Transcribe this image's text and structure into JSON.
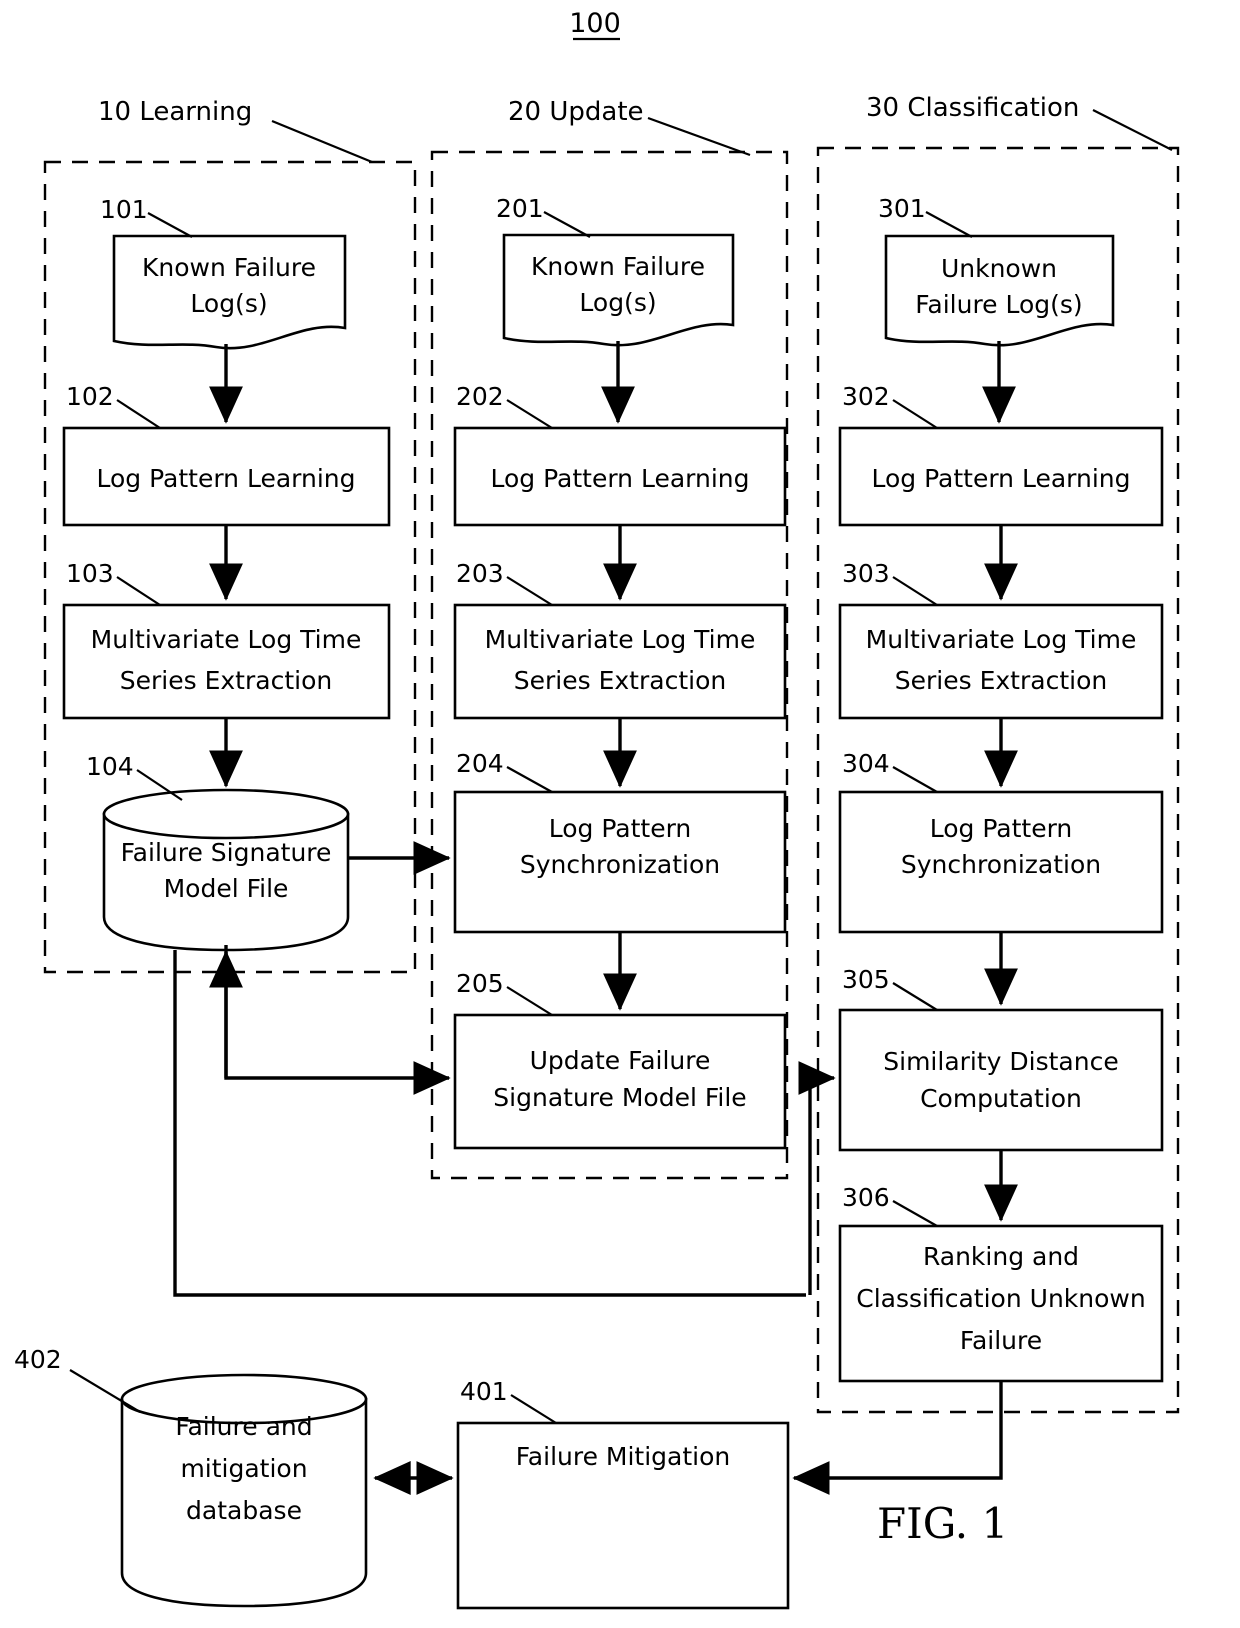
{
  "figure": {
    "number_label": "100",
    "caption": "FIG. 1"
  },
  "phases": [
    {
      "id": "learning",
      "label": "10 Learning"
    },
    {
      "id": "update",
      "label": "20 Update"
    },
    {
      "id": "classification",
      "label": "30 Classification"
    }
  ],
  "nodes": {
    "n101": {
      "ref": "101",
      "line1": "Known Failure",
      "line2": "Log(s)",
      "shape": "document"
    },
    "n102": {
      "ref": "102",
      "line1": "Log Pattern Learning",
      "line2": "",
      "shape": "process"
    },
    "n103": {
      "ref": "103",
      "line1": "Multivariate Log Time",
      "line2": "Series Extraction",
      "shape": "process"
    },
    "n104": {
      "ref": "104",
      "line1": "Failure Signature",
      "line2": "Model File",
      "shape": "cylinder"
    },
    "n201": {
      "ref": "201",
      "line1": "Known Failure",
      "line2": "Log(s)",
      "shape": "document"
    },
    "n202": {
      "ref": "202",
      "line1": "Log Pattern Learning",
      "line2": "",
      "shape": "process"
    },
    "n203": {
      "ref": "203",
      "line1": "Multivariate Log Time",
      "line2": "Series Extraction",
      "shape": "process"
    },
    "n204": {
      "ref": "204",
      "line1": "Log Pattern",
      "line2": "Synchronization",
      "shape": "process"
    },
    "n205": {
      "ref": "205",
      "line1": "Update Failure",
      "line2": "Signature Model File",
      "shape": "process"
    },
    "n301": {
      "ref": "301",
      "line1": "Unknown",
      "line2": "Failure Log(s)",
      "shape": "document"
    },
    "n302": {
      "ref": "302",
      "line1": "Log Pattern Learning",
      "line2": "",
      "shape": "process"
    },
    "n303": {
      "ref": "303",
      "line1": "Multivariate Log Time",
      "line2": "Series Extraction",
      "shape": "process"
    },
    "n304": {
      "ref": "304",
      "line1": "Log Pattern",
      "line2": "Synchronization",
      "shape": "process"
    },
    "n305": {
      "ref": "305",
      "line1": "Similarity Distance",
      "line2": "Computation",
      "shape": "process"
    },
    "n306": {
      "ref": "306",
      "line1": "Ranking and",
      "line2": "Classification Unknown",
      "line3": "Failure",
      "shape": "process"
    },
    "n401": {
      "ref": "401",
      "line1": "Failure Mitigation",
      "line2": "",
      "shape": "process"
    },
    "n402": {
      "ref": "402",
      "line1": "Failure and",
      "line2": "mitigation",
      "line3": "database",
      "shape": "cylinder"
    }
  },
  "colors": {
    "stroke": "#000000",
    "background": "#ffffff"
  }
}
